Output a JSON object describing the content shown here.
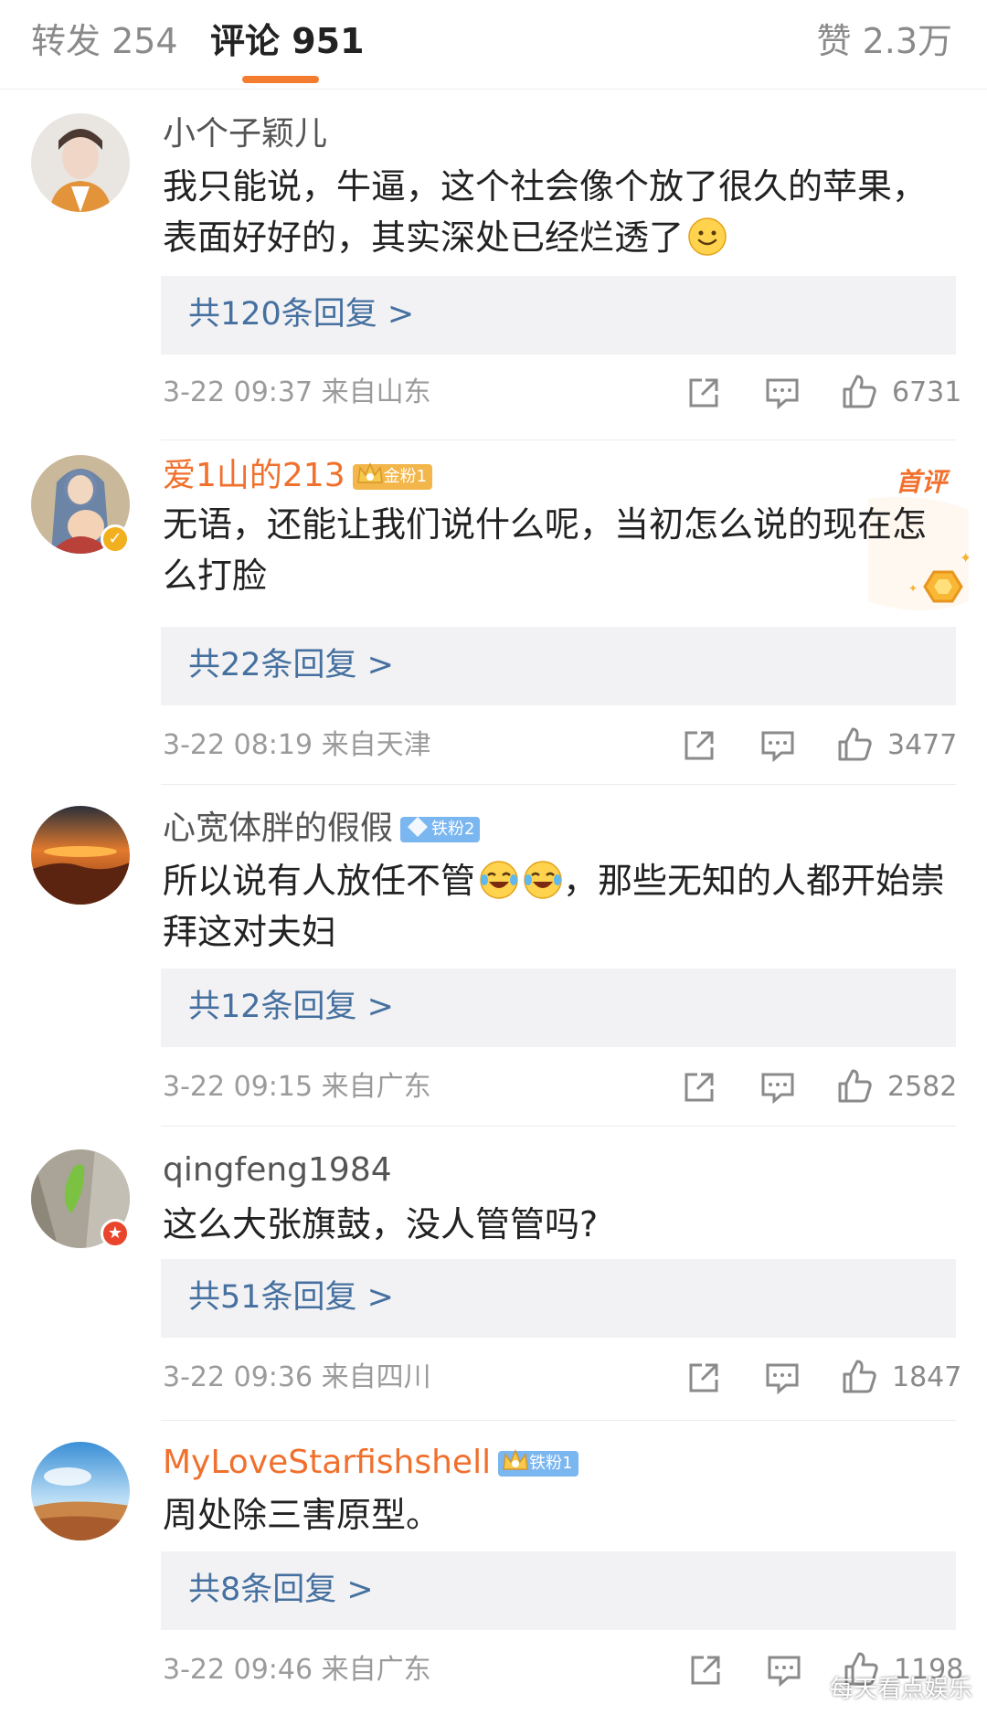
{
  "tabs": {
    "repost": "转发 254",
    "comments": "评论 951",
    "likes": "赞 2.3万",
    "active": "comments"
  },
  "colors": {
    "accent": "#f47c2f",
    "username_vip": "#f0702d",
    "reply_link": "#45709f",
    "meta_gray": "#9b9b9b"
  },
  "comments": [
    {
      "username": "小个子颖儿",
      "badge": "",
      "text": "我只能说，牛逼，这个社会像个放了很久的苹果，表面好好的，其实深处已经烂透了",
      "emoji": "smile-emoji",
      "replies": "共120条回复 >",
      "time": "3-22 09:37",
      "location": "来自山东",
      "likes": "6731"
    },
    {
      "username": "爱1山的213",
      "badge": "金粉1",
      "first_tag": "首评",
      "text": "无语，还能让我们说什么呢，当初怎么说的现在怎么打脸",
      "replies": "共22条回复 >",
      "time": "3-22 08:19",
      "location": "来自天津",
      "likes": "3477"
    },
    {
      "username": "心宽体胖的假假",
      "badge": "铁粉2",
      "text_before": "所以说有人放任不管",
      "text_after": "，那些无知的人都开始崇拜这对夫妇",
      "emoji": "tears-of-joy-emoji",
      "replies": "共12条回复 >",
      "time": "3-22 09:15",
      "location": "来自广东",
      "likes": "2582"
    },
    {
      "username": "qingfeng1984",
      "badge": "",
      "text": "这么大张旗鼓，没人管管吗?",
      "replies": "共51条回复 >",
      "time": "3-22 09:36",
      "location": "来自四川",
      "likes": "1847"
    },
    {
      "username": "MyLoveStarfishshell",
      "badge": "铁粉1",
      "text": "周处除三害原型。",
      "replies": "共8条回复 >",
      "time": "3-22 09:46",
      "location": "来自广东",
      "likes": "1198"
    }
  ],
  "watermark": "每天看点娱乐"
}
